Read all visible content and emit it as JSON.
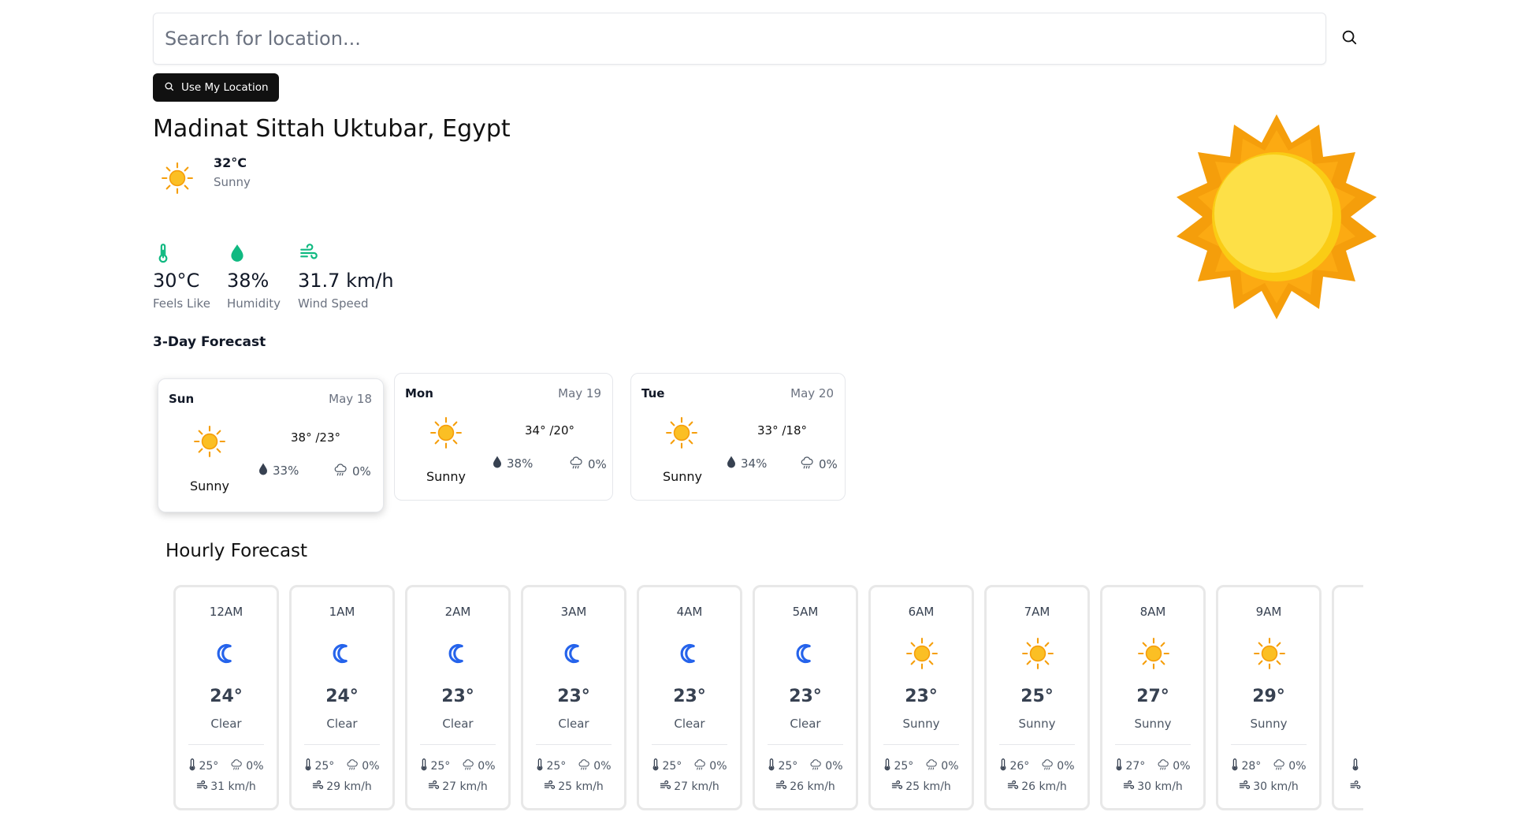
{
  "search": {
    "placeholder": "Search for location..."
  },
  "location_button": {
    "label": "Use My Location"
  },
  "current": {
    "city": "Madinat Sittah Uktubar, Egypt",
    "temp": "32°C",
    "condition": "Sunny",
    "icon": "sun-icon"
  },
  "stats": [
    {
      "value": "30°C",
      "label": "Feels Like",
      "icon": "thermometer-icon"
    },
    {
      "value": "38%",
      "label": "Humidity",
      "icon": "droplet-icon"
    },
    {
      "value": "31.7 km/h",
      "label": "Wind Speed",
      "icon": "wind-icon"
    }
  ],
  "forecast": {
    "title": "3-Day Forecast",
    "days": [
      {
        "day": "Sun",
        "date": "May 18",
        "high": "38°",
        "low": "/23°",
        "condition": "Sunny",
        "humidity": "33%",
        "rain": "0%",
        "icon": "sun-icon"
      },
      {
        "day": "Mon",
        "date": "May 19",
        "high": "34°",
        "low": "/20°",
        "condition": "Sunny",
        "humidity": "38%",
        "rain": "0%",
        "icon": "sun-icon"
      },
      {
        "day": "Tue",
        "date": "May 20",
        "high": "33°",
        "low": "/18°",
        "condition": "Sunny",
        "humidity": "34%",
        "rain": "0%",
        "icon": "sun-icon"
      }
    ]
  },
  "hourly": {
    "title": "Hourly Forecast",
    "hours": [
      {
        "time": "12AM",
        "temp": "24°",
        "condition": "Clear",
        "feels": "25°",
        "rain": "0%",
        "wind": "31 km/h",
        "icon": "moon-icon"
      },
      {
        "time": "1AM",
        "temp": "24°",
        "condition": "Clear",
        "feels": "25°",
        "rain": "0%",
        "wind": "29 km/h",
        "icon": "moon-icon"
      },
      {
        "time": "2AM",
        "temp": "23°",
        "condition": "Clear",
        "feels": "25°",
        "rain": "0%",
        "wind": "27 km/h",
        "icon": "moon-icon"
      },
      {
        "time": "3AM",
        "temp": "23°",
        "condition": "Clear",
        "feels": "25°",
        "rain": "0%",
        "wind": "25 km/h",
        "icon": "moon-icon"
      },
      {
        "time": "4AM",
        "temp": "23°",
        "condition": "Clear",
        "feels": "25°",
        "rain": "0%",
        "wind": "27 km/h",
        "icon": "moon-icon"
      },
      {
        "time": "5AM",
        "temp": "23°",
        "condition": "Clear",
        "feels": "25°",
        "rain": "0%",
        "wind": "26 km/h",
        "icon": "moon-icon"
      },
      {
        "time": "6AM",
        "temp": "23°",
        "condition": "Sunny",
        "feels": "25°",
        "rain": "0%",
        "wind": "25 km/h",
        "icon": "sun-icon"
      },
      {
        "time": "7AM",
        "temp": "25°",
        "condition": "Sunny",
        "feels": "26°",
        "rain": "0%",
        "wind": "26 km/h",
        "icon": "sun-icon"
      },
      {
        "time": "8AM",
        "temp": "27°",
        "condition": "Sunny",
        "feels": "27°",
        "rain": "0%",
        "wind": "30 km/h",
        "icon": "sun-icon"
      },
      {
        "time": "9AM",
        "temp": "29°",
        "condition": "Sunny",
        "feels": "28°",
        "rain": "0%",
        "wind": "30 km/h",
        "icon": "sun-icon"
      }
    ]
  },
  "colors": {
    "accent": "#10b981",
    "sun": "#fbbf24",
    "sun_ray": "#f59e0b",
    "moon": "#2563eb",
    "button_bg": "#111111"
  }
}
